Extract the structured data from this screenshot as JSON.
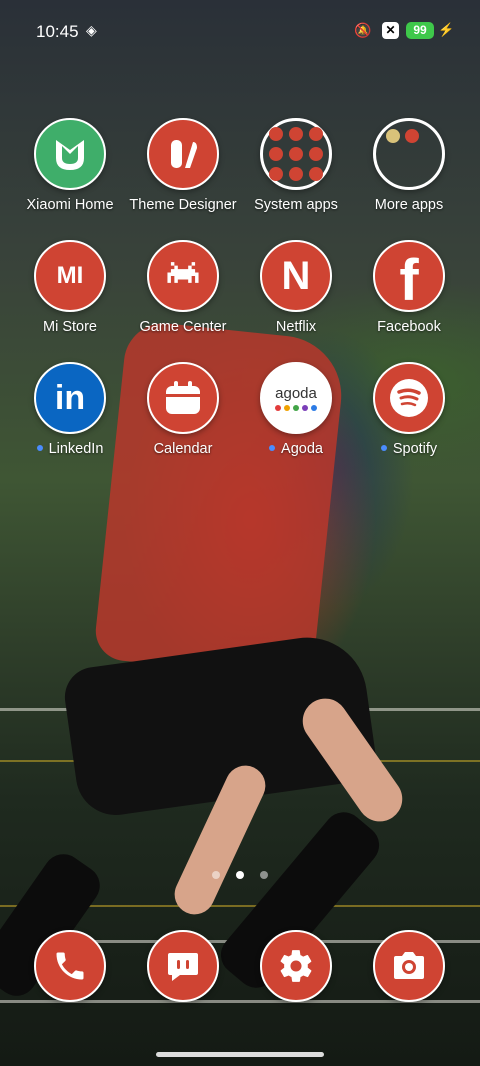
{
  "status_bar": {
    "time": "10:45",
    "battery": "99",
    "battery_color": "#3ec84a"
  },
  "apps_row1": [
    {
      "name": "Xiaomi Home"
    },
    {
      "name": "Theme Designer"
    },
    {
      "name": "System apps"
    },
    {
      "name": "More apps"
    }
  ],
  "apps_row2": [
    {
      "name": "Mi Store"
    },
    {
      "name": "Game Center"
    },
    {
      "name": "Netflix"
    },
    {
      "name": "Facebook"
    }
  ],
  "apps_row3": [
    {
      "name": "LinkedIn"
    },
    {
      "name": "Calendar"
    },
    {
      "name": "Agoda"
    },
    {
      "name": "Spotify"
    }
  ],
  "dock": [
    {
      "icon": "phone-icon"
    },
    {
      "icon": "messages-icon"
    },
    {
      "icon": "settings-icon"
    },
    {
      "icon": "camera-icon"
    }
  ],
  "icons": {
    "mi_store": "MI",
    "netflix": "N",
    "facebook": "f",
    "linkedin": "in",
    "agoda": "agoda"
  },
  "pager": {
    "pages": 3,
    "active": 2
  },
  "colors": {
    "icon_red": "#cf4433",
    "xiaomi_home_green": "#3fae6a",
    "linkedin_blue": "#0a66c2",
    "new_dot": "#4a8cff"
  }
}
